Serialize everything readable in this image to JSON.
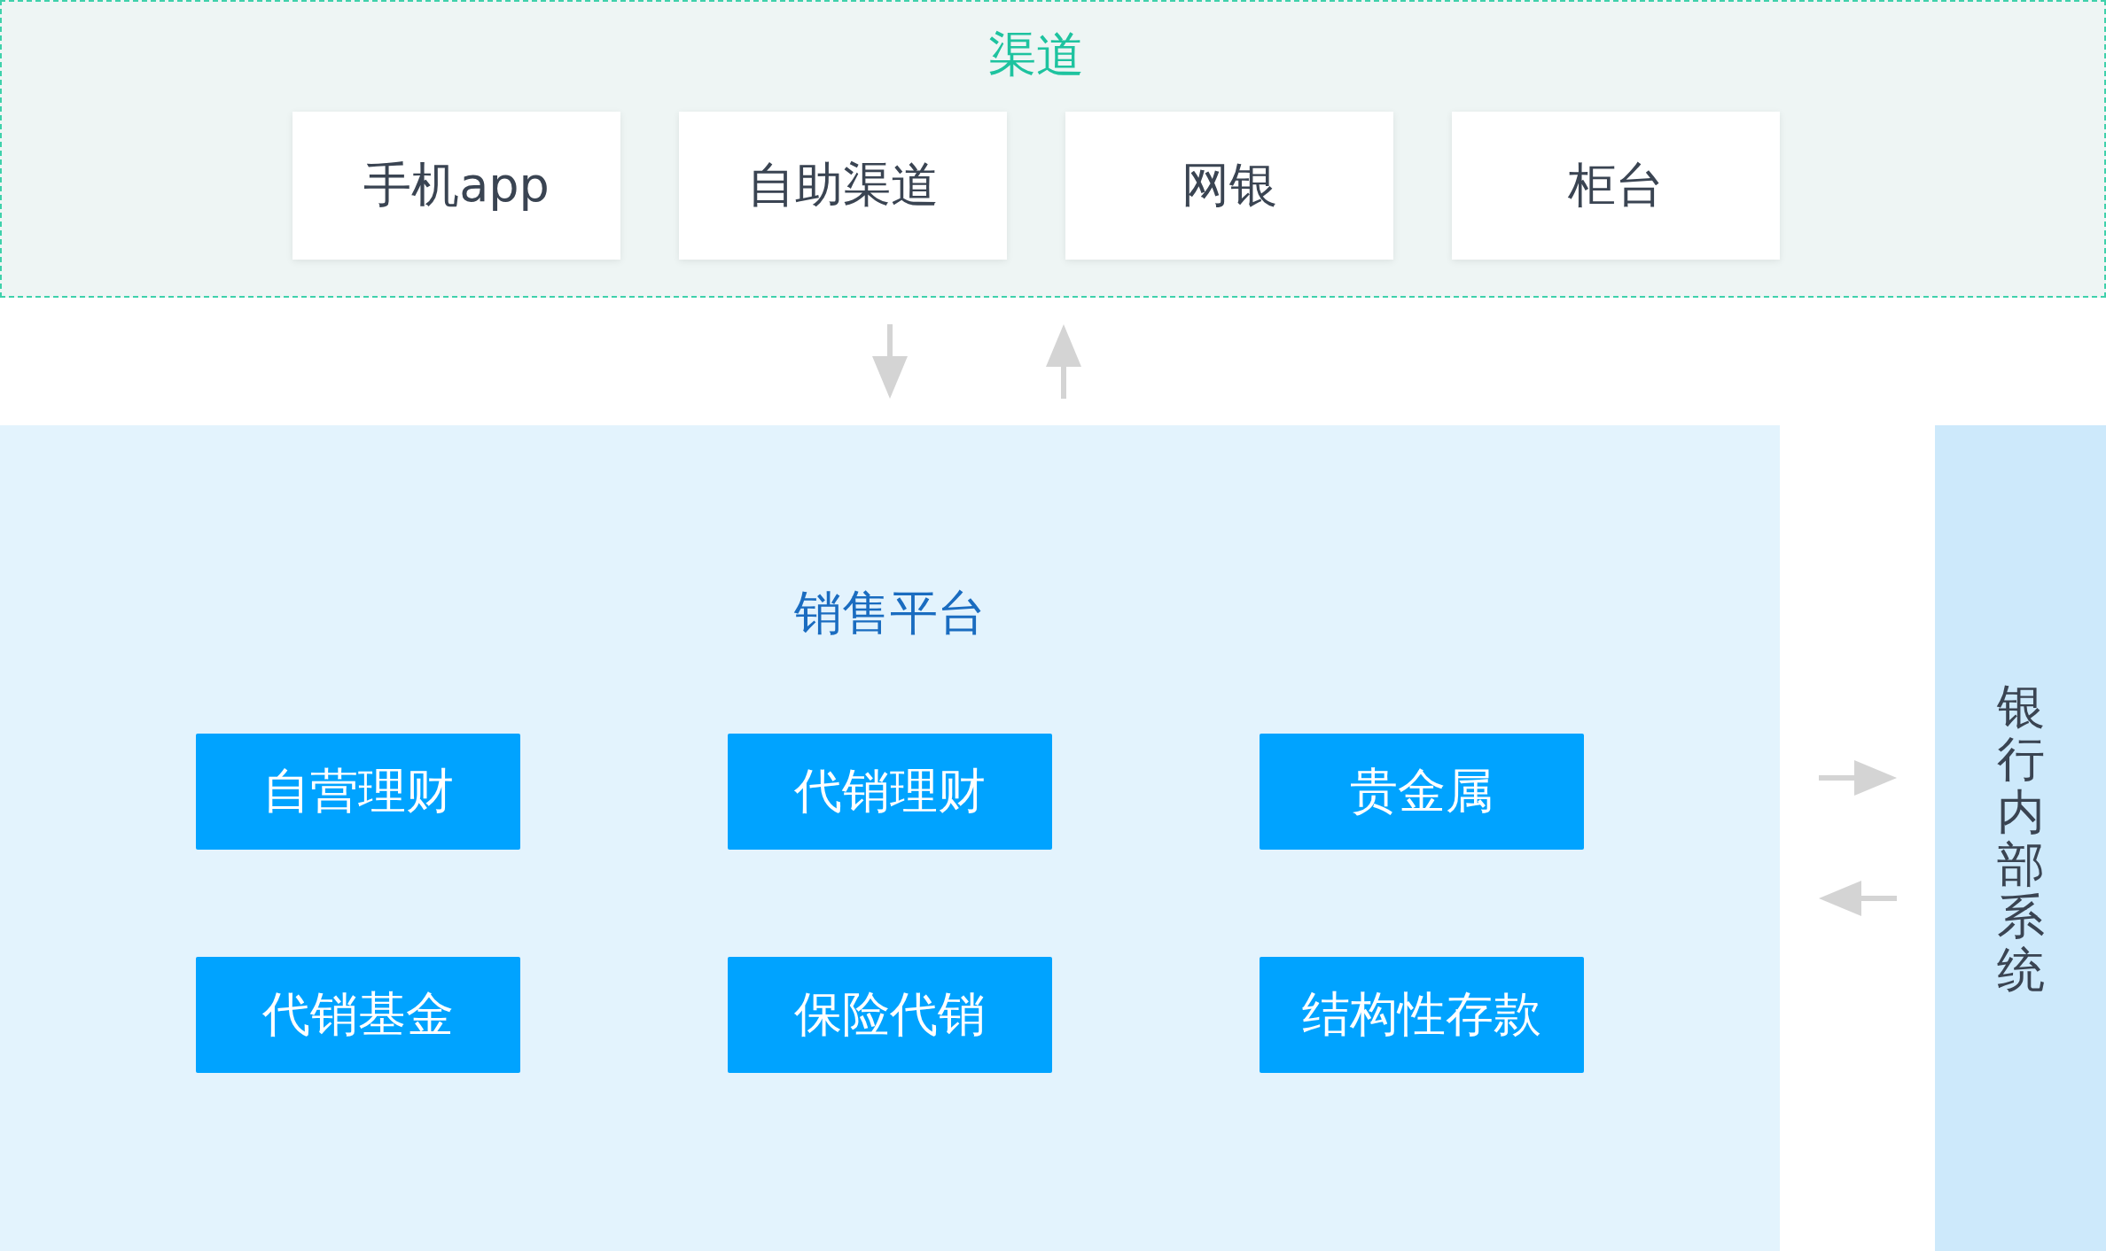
{
  "channels": {
    "title": "渠道",
    "items": [
      "手机app",
      "自助渠道",
      "网银",
      "柜台"
    ]
  },
  "sales_platform": {
    "title": "销售平台",
    "products": [
      "自营理财",
      "代销理财",
      "贵金属",
      "代销基金",
      "保险代销",
      "结构性存款"
    ]
  },
  "internal_system": {
    "title": "银行内部系统"
  }
}
